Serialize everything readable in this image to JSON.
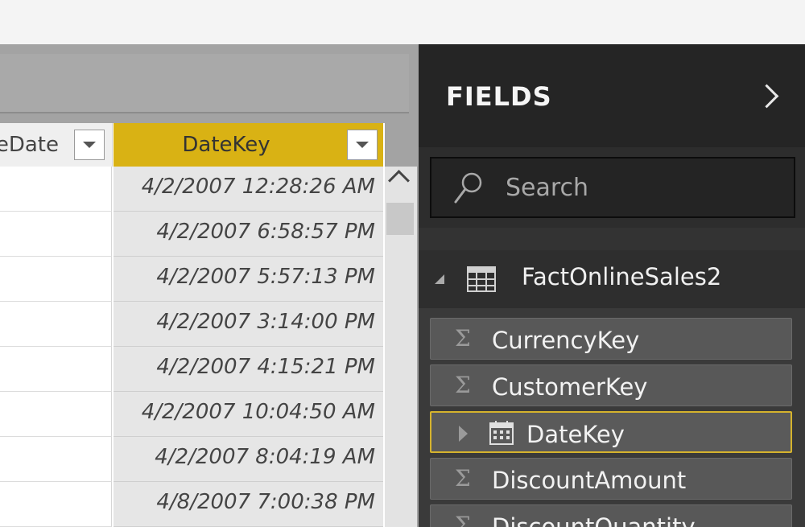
{
  "grid": {
    "left_header_label": "eDate",
    "date_key_header": "DateKey",
    "rows": [
      "4/2/2007 12:28:26 AM",
      "4/2/2007 6:58:57 PM",
      "4/2/2007 5:57:13 PM",
      "4/2/2007 3:14:00 PM",
      "4/2/2007 4:15:21 PM",
      "4/2/2007 10:04:50 AM",
      "4/2/2007 8:04:19 AM",
      "4/8/2007 7:00:38 PM"
    ]
  },
  "fields_pane": {
    "title": "FIELDS",
    "search_placeholder": "Search",
    "table_name": "FactOnlineSales2",
    "fields": [
      {
        "label": "CurrencyKey",
        "icon": "sigma-icon"
      },
      {
        "label": "CustomerKey",
        "icon": "sigma-icon"
      },
      {
        "label": "DateKey",
        "icon": "calendar-icon",
        "selected": true
      },
      {
        "label": "DiscountAmount",
        "icon": "sigma-icon"
      },
      {
        "label": "DiscountQuantity",
        "icon": "sigma-icon"
      }
    ]
  },
  "colors": {
    "selected_header": "#d9b214",
    "pane_background": "#3a3a3a",
    "selected_field_border": "#d5b32d"
  }
}
